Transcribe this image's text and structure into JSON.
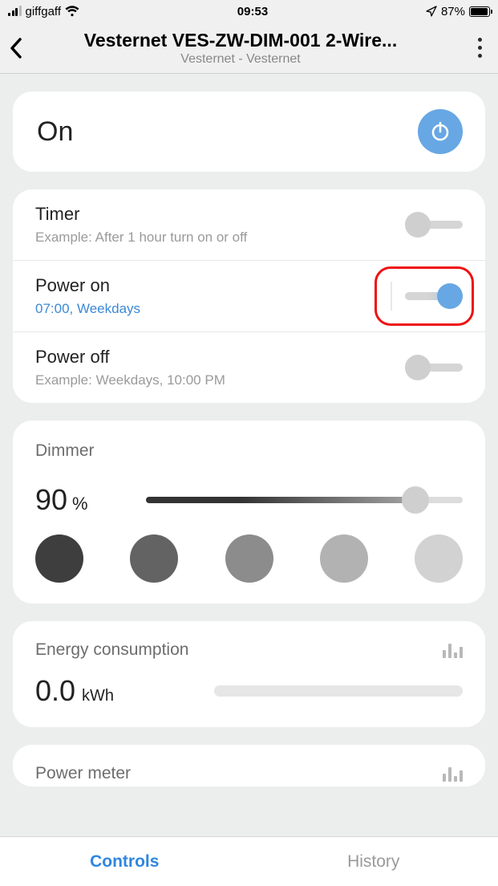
{
  "status": {
    "carrier": "giffgaff",
    "time": "09:53",
    "battery": "87%"
  },
  "header": {
    "title": "Vesternet VES-ZW-DIM-001 2-Wire...",
    "subtitle": "Vesternet - Vesternet"
  },
  "state": {
    "label": "On"
  },
  "schedule": {
    "timer": {
      "label": "Timer",
      "sub": "Example: After 1 hour turn on or off",
      "on": false
    },
    "poweron": {
      "label": "Power on",
      "sub": "07:00, Weekdays",
      "on": true
    },
    "poweroff": {
      "label": "Power off",
      "sub": "Example: Weekdays, 10:00 PM",
      "on": false
    }
  },
  "dimmer": {
    "title": "Dimmer",
    "value": "90",
    "unit": "%",
    "presets": [
      "#3e3e3e",
      "#636363",
      "#8c8c8c",
      "#b2b2b2",
      "#d2d2d2"
    ]
  },
  "energy": {
    "title": "Energy consumption",
    "value": "0.0",
    "unit": "kWh"
  },
  "meter": {
    "title": "Power meter"
  },
  "tabs": {
    "controls": "Controls",
    "history": "History"
  }
}
